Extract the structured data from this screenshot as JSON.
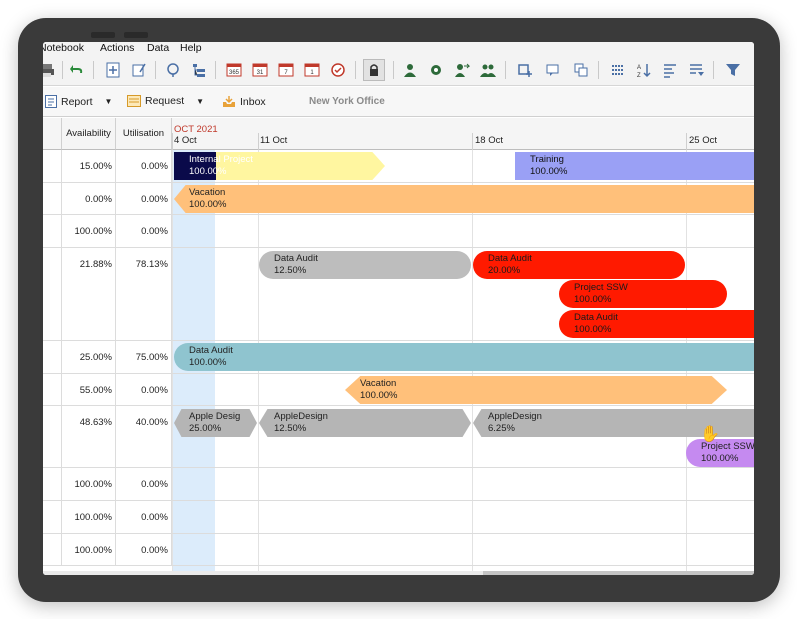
{
  "menu": [
    "Notebook",
    "Actions",
    "Data",
    "Help"
  ],
  "subbar": {
    "report": "Report",
    "request": "Request",
    "inbox": "Inbox",
    "office": "New York Office"
  },
  "columns": {
    "availability": "Availability",
    "utilisation": "Utilisation"
  },
  "timeline": {
    "month": "OCT 2021",
    "weeks": [
      "4 Oct",
      "11 Oct",
      "18 Oct",
      "25 Oct"
    ]
  },
  "rows": [
    {
      "availability": "15.00%",
      "utilisation": "0.00%"
    },
    {
      "availability": "0.00%",
      "utilisation": "0.00%"
    },
    {
      "availability": "100.00%",
      "utilisation": "0.00%"
    },
    {
      "availability": "21.88%",
      "utilisation": "78.13%"
    },
    {
      "availability": "25.00%",
      "utilisation": "75.00%"
    },
    {
      "availability": "55.00%",
      "utilisation": "0.00%"
    },
    {
      "availability": "48.63%",
      "utilisation": "40.00%"
    },
    {
      "availability": "100.00%",
      "utilisation": "0.00%"
    },
    {
      "availability": "100.00%",
      "utilisation": "0.00%"
    },
    {
      "availability": "100.00%",
      "utilisation": "0.00%"
    }
  ],
  "bars": [
    {
      "name": "Internal Project",
      "value": "100.00%",
      "color": "#fff6a0"
    },
    {
      "name": "Training",
      "value": "100.00%",
      "color": "#9aa0f5"
    },
    {
      "name": "Vacation",
      "value": "100.00%",
      "color": "#ffc07a"
    },
    {
      "name": "Data Audit",
      "value": "12.50%",
      "color": "#bdbdbd"
    },
    {
      "name": "Data Audit",
      "value": "20.00%",
      "color": "#ff1a00"
    },
    {
      "name": "Project SSW",
      "value": "100.00%",
      "color": "#ff1a00"
    },
    {
      "name": "Data Audit",
      "value": "100.00%",
      "color": "#ff1a00"
    },
    {
      "name": "Data Audit",
      "value": "100.00%",
      "color": "#8fc4cf"
    },
    {
      "name": "Vacation",
      "value": "100.00%",
      "color": "#ffc07a"
    },
    {
      "name": "Apple Desig",
      "value": "25.00%",
      "color": "#b5b5b5"
    },
    {
      "name": "AppleDesign",
      "value": "12.50%",
      "color": "#b5b5b5"
    },
    {
      "name": "AppleDesign",
      "value": "6.25%",
      "color": "#b5b5b5"
    },
    {
      "name": "Project SSW",
      "value": "100.00%",
      "color": "#c58af0"
    }
  ]
}
